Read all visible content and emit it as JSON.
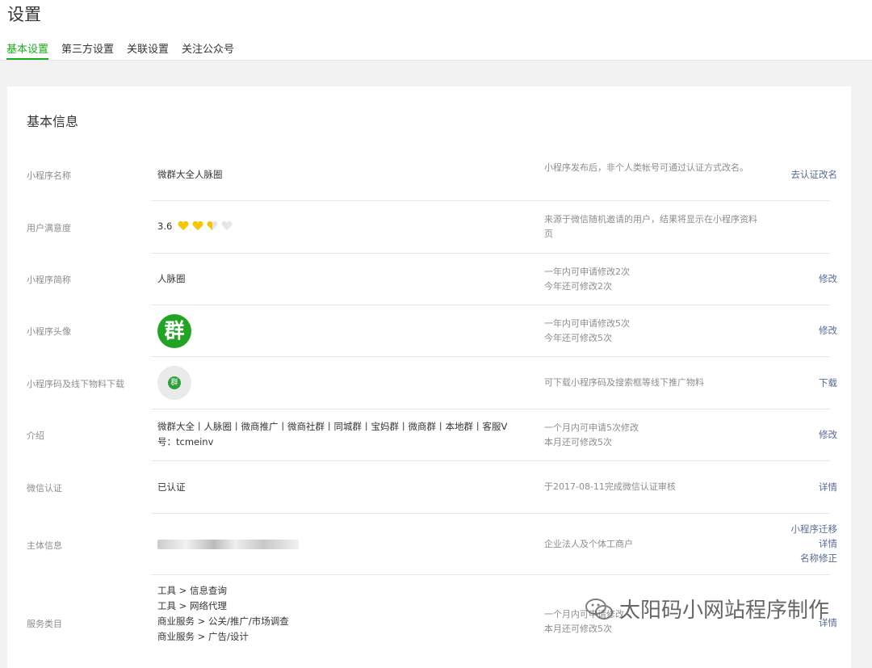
{
  "header": {
    "title": "设置",
    "tabs": [
      {
        "label": "基本设置",
        "active": true
      },
      {
        "label": "第三方设置",
        "active": false
      },
      {
        "label": "关联设置",
        "active": false
      },
      {
        "label": "关注公众号",
        "active": false
      }
    ]
  },
  "panel": {
    "title": "基本信息",
    "rows": {
      "name": {
        "label": "小程序名称",
        "value": "微群大全人脉圈",
        "tip": "小程序发布后，非个人类帐号可通过认证方式改名。",
        "action": "去认证改名"
      },
      "rating": {
        "label": "用户满意度",
        "score": "3.6",
        "hearts": 2.5,
        "tip": "来源于微信随机邀请的用户，结果将显示在小程序资料页"
      },
      "short_name": {
        "label": "小程序简称",
        "value": "人脉圈",
        "tip1": "一年内可申请修改2次",
        "tip2": "今年还可修改2次",
        "action": "修改"
      },
      "avatar": {
        "label": "小程序头像",
        "avatar_char": "群",
        "tip1": "一年内可申请修改5次",
        "tip2": "今年还可修改5次",
        "action": "修改"
      },
      "qrcode": {
        "label": "小程序码及线下物料下载",
        "qr_char": "群",
        "tip": "可下载小程序码及搜索框等线下推广物料",
        "action": "下载"
      },
      "intro": {
        "label": "介绍",
        "value": "微群大全丨人脉圈丨微商推广丨微商社群丨同城群丨宝妈群丨微商群丨本地群丨客服V号：tcmeinv",
        "tip1": "一个月内可申请5次修改",
        "tip2": "本月还可修改5次",
        "action": "修改"
      },
      "verify": {
        "label": "微信认证",
        "value": "已认证",
        "tip": "于2017-08-11完成微信认证审核",
        "action": "详情"
      },
      "subject": {
        "label": "主体信息",
        "tip": "企业法人及个体工商户",
        "action1": "小程序迁移",
        "action2": "详情",
        "action3": "名称修正"
      },
      "service": {
        "label": "服务类目",
        "items": [
          "工具 > 信息查询",
          "工具 > 网络代理",
          "商业服务 > 公关/推广/市场调查",
          "商业服务 > 广告/设计"
        ],
        "tip1": "一个月内可申请修改",
        "tip2": "本月还可修改5次",
        "action": "详情"
      }
    }
  },
  "watermark": {
    "text": "太阳码小网站程序制作"
  },
  "colors": {
    "accent_green": "#1aad19",
    "link_blue": "#576b95",
    "heart_gold": "#f7c600",
    "heart_empty": "#e6e6e6"
  }
}
